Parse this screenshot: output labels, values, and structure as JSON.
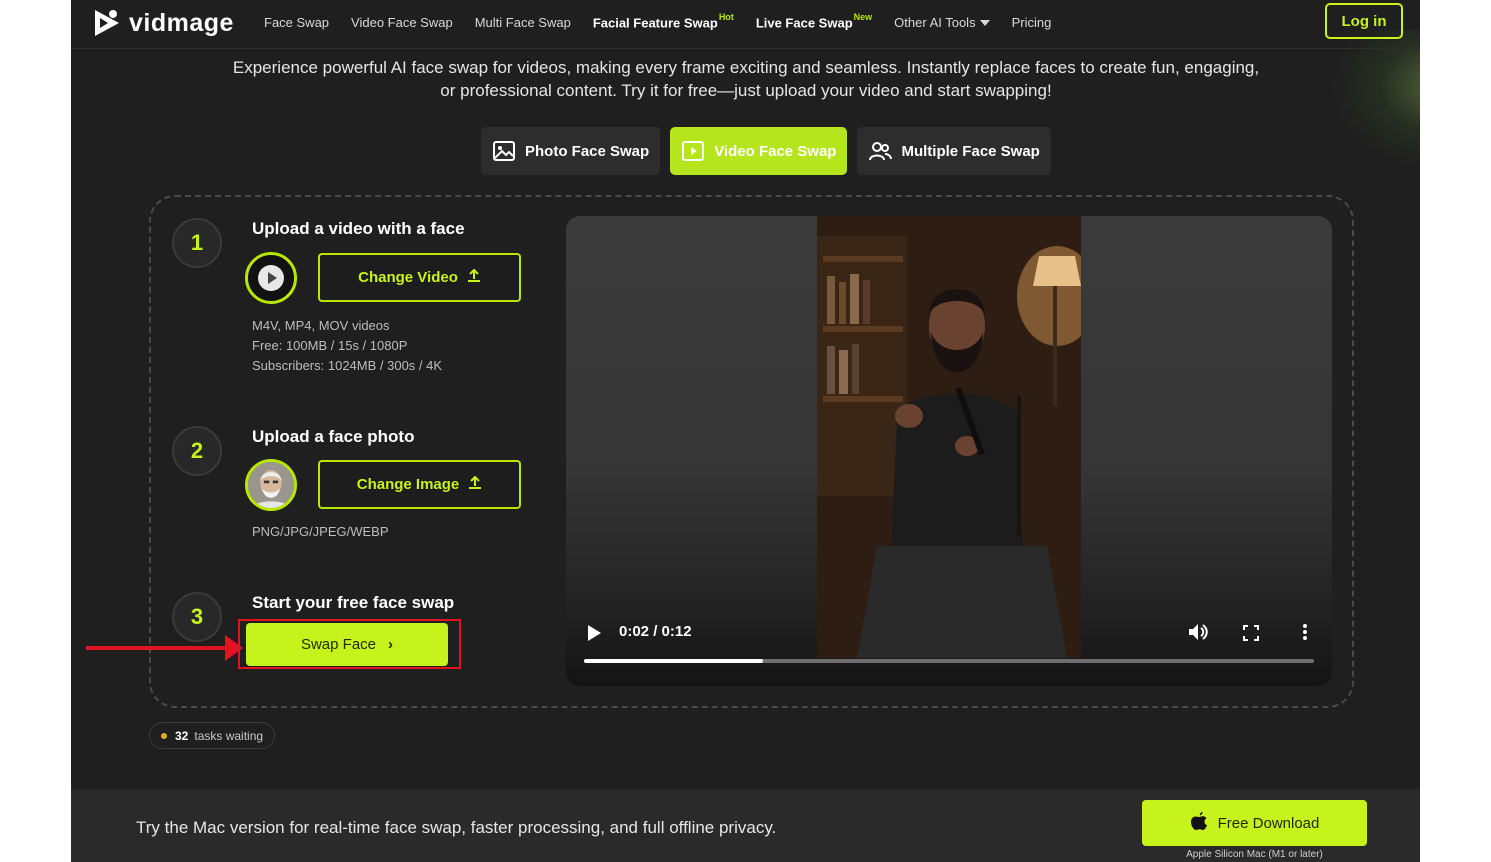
{
  "brand": {
    "name": "vidmage",
    "accent": "#c6f31b"
  },
  "nav": {
    "links": [
      {
        "label": "Face Swap"
      },
      {
        "label": "Video Face Swap"
      },
      {
        "label": "Multi Face Swap"
      },
      {
        "label": "Facial Feature Swap",
        "badge": "Hot"
      },
      {
        "label": "Live Face Swap",
        "badge": "New"
      },
      {
        "label": "Other AI Tools"
      },
      {
        "label": "Pricing"
      }
    ],
    "login_label": "Log in"
  },
  "hero": {
    "line1": "Experience powerful AI face swap for videos, making every frame exciting and seamless. Instantly replace faces to create fun, engaging,",
    "line2": "or professional content. Try it for free—just upload your video and start swapping!"
  },
  "mode_tabs": [
    {
      "label": "Photo Face Swap",
      "icon": "image-icon",
      "active": false
    },
    {
      "label": "Video Face Swap",
      "icon": "video-play-icon",
      "active": true
    },
    {
      "label": "Multiple Face Swap",
      "icon": "people-icon",
      "active": false
    }
  ],
  "steps": {
    "step1": {
      "number": "1",
      "title": "Upload a video with a face",
      "button_label": "Change Video",
      "formats": "M4V, MP4, MOV videos",
      "free_limits": "Free: 100MB / 15s / 1080P",
      "sub_limits": "Subscribers: 1024MB / 300s / 4K"
    },
    "step2": {
      "number": "2",
      "title": "Upload a face photo",
      "button_label": "Change Image",
      "formats": "PNG/JPG/JPEG/WEBP"
    },
    "step3": {
      "number": "3",
      "title": "Start your free face swap",
      "button_label": "Swap Face"
    }
  },
  "video": {
    "time_display": "0:02 / 0:12",
    "progress": 0.245
  },
  "tasks": {
    "count": "32",
    "label": "tasks waiting"
  },
  "bottom": {
    "promo": "Try the Mac version for real-time face swap, faster processing, and full offline privacy.",
    "download_label": "Free Download",
    "download_note": "Apple Silicon Mac (M1 or later)"
  },
  "annotation": {
    "color": "#e0141e"
  }
}
